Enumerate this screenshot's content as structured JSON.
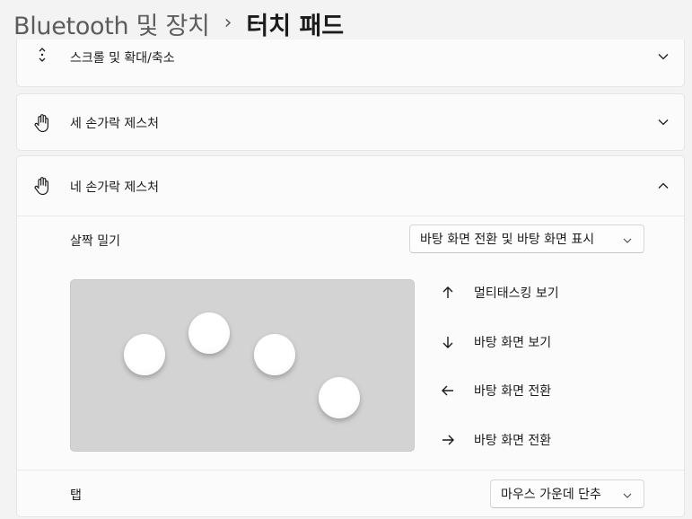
{
  "breadcrumb": {
    "parent": "Bluetooth 및 장치",
    "separator": "›",
    "current": "터치 패드"
  },
  "sections": {
    "scroll_zoom": {
      "label": "스크롤 및 확대/축소",
      "icon": "scroll-arrows-icon",
      "expanded": false
    },
    "three_finger": {
      "label": "세 손가락 제스처",
      "icon": "hand-icon",
      "expanded": false
    },
    "four_finger": {
      "label": "네 손가락 제스처",
      "icon": "hand-icon",
      "expanded": true,
      "swipe": {
        "label": "살짝 밀기",
        "selected": "바탕 화면 전환 및 바탕 화면 표시"
      },
      "gesture_legend": [
        {
          "arrow": "up-arrow-icon",
          "text": "멀티태스킹 보기"
        },
        {
          "arrow": "down-arrow-icon",
          "text": "바탕 화면 보기"
        },
        {
          "arrow": "left-arrow-icon",
          "text": "바탕 화면 전환"
        },
        {
          "arrow": "right-arrow-icon",
          "text": "바탕 화면 전환"
        }
      ],
      "tap": {
        "label": "탭",
        "selected": "마우스 가운데 단추"
      }
    }
  },
  "colors": {
    "background": "#f3f3f3",
    "card": "#fbfbfb",
    "touchpad": "#d3d3d3"
  }
}
